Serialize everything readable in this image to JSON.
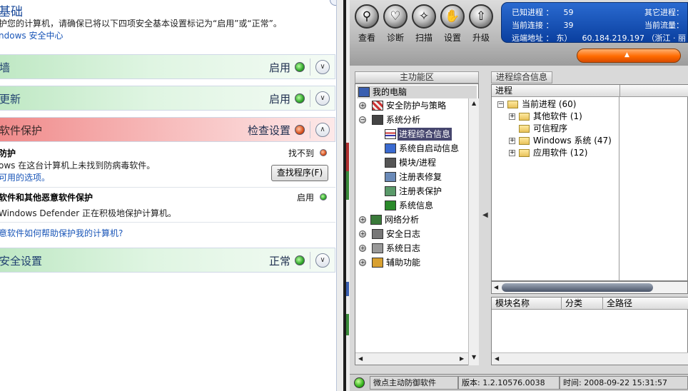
{
  "security_center": {
    "title": "基础",
    "subtitle": "护您的计算机，请确保已将以下四项安全基本设置标记为“启用”或“正常”。",
    "link": "ndows 安全中心",
    "sections": [
      {
        "label": "墙",
        "status": "启用",
        "color": "green"
      },
      {
        "label": "更新",
        "status": "启用",
        "color": "green"
      },
      {
        "label": "软件保护",
        "status": "检查设置",
        "color": "red"
      },
      {
        "label": "安全设置",
        "status": "正常",
        "color": "green"
      }
    ],
    "virus": {
      "title": "防护",
      "status": "找不到",
      "line1": "ows 在这台计算机上未找到防病毒软件。",
      "line2": "可用的选项。",
      "button": "查找程序(F)"
    },
    "spyware": {
      "title": "软件和其他恶意软件保护",
      "status": "启用",
      "line1": "Windows Defender 正在积极地保护计算机。"
    },
    "help_link": "意软件如何帮助保护我的计算机?"
  },
  "vdian": {
    "toolbar": [
      "查看",
      "诊断",
      "扫描",
      "设置",
      "升级"
    ],
    "info": {
      "known_label": "已知进程 ：",
      "known_value": "59",
      "other_label": "其它进程：",
      "conn_label": "当前连接 ：",
      "conn_value": "39",
      "traffic_label": "当前流量：",
      "remote_label": "远端地址 ：",
      "remote_value": "东）",
      "remote_ip": "60.184.219.197 （浙江 · 丽"
    },
    "left_panel_title": "主功能区",
    "tree": [
      {
        "label": "我的电脑",
        "level": 0,
        "toggle": ""
      },
      {
        "label": "安全防护与策略",
        "level": 1,
        "toggle": "+"
      },
      {
        "label": "系统分析",
        "level": 1,
        "toggle": "−"
      },
      {
        "label": "进程综合信息",
        "level": 2,
        "toggle": "",
        "selected": true
      },
      {
        "label": "系统自启动信息",
        "level": 2,
        "toggle": ""
      },
      {
        "label": "模块/进程",
        "level": 2,
        "toggle": ""
      },
      {
        "label": "注册表修复",
        "level": 2,
        "toggle": ""
      },
      {
        "label": "注册表保护",
        "level": 2,
        "toggle": ""
      },
      {
        "label": "系统信息",
        "level": 2,
        "toggle": ""
      },
      {
        "label": "网络分析",
        "level": 1,
        "toggle": "+"
      },
      {
        "label": "安全日志",
        "level": 1,
        "toggle": "+"
      },
      {
        "label": "系统日志",
        "level": 1,
        "toggle": "+"
      },
      {
        "label": "辅助功能",
        "level": 1,
        "toggle": "+"
      }
    ],
    "right_tab": "进程综合信息",
    "proc_column": "进程",
    "processes": [
      {
        "label": "当前进程 (60)",
        "indent": 0,
        "toggle": "−"
      },
      {
        "label": "其他软件 (1)",
        "indent": 1,
        "toggle": "+"
      },
      {
        "label": "可信程序",
        "indent": 1,
        "toggle": ""
      },
      {
        "label": "Windows 系统 (47)",
        "indent": 1,
        "toggle": "+"
      },
      {
        "label": "应用软件 (12)",
        "indent": 1,
        "toggle": "+"
      }
    ],
    "module_columns": [
      "模块名称",
      "分类",
      "全路径"
    ],
    "status": {
      "app": "微点主动防御软件",
      "version": "版本: 1.2.10576.0038",
      "time": "时间: 2008-09-22 15:31:57"
    }
  }
}
